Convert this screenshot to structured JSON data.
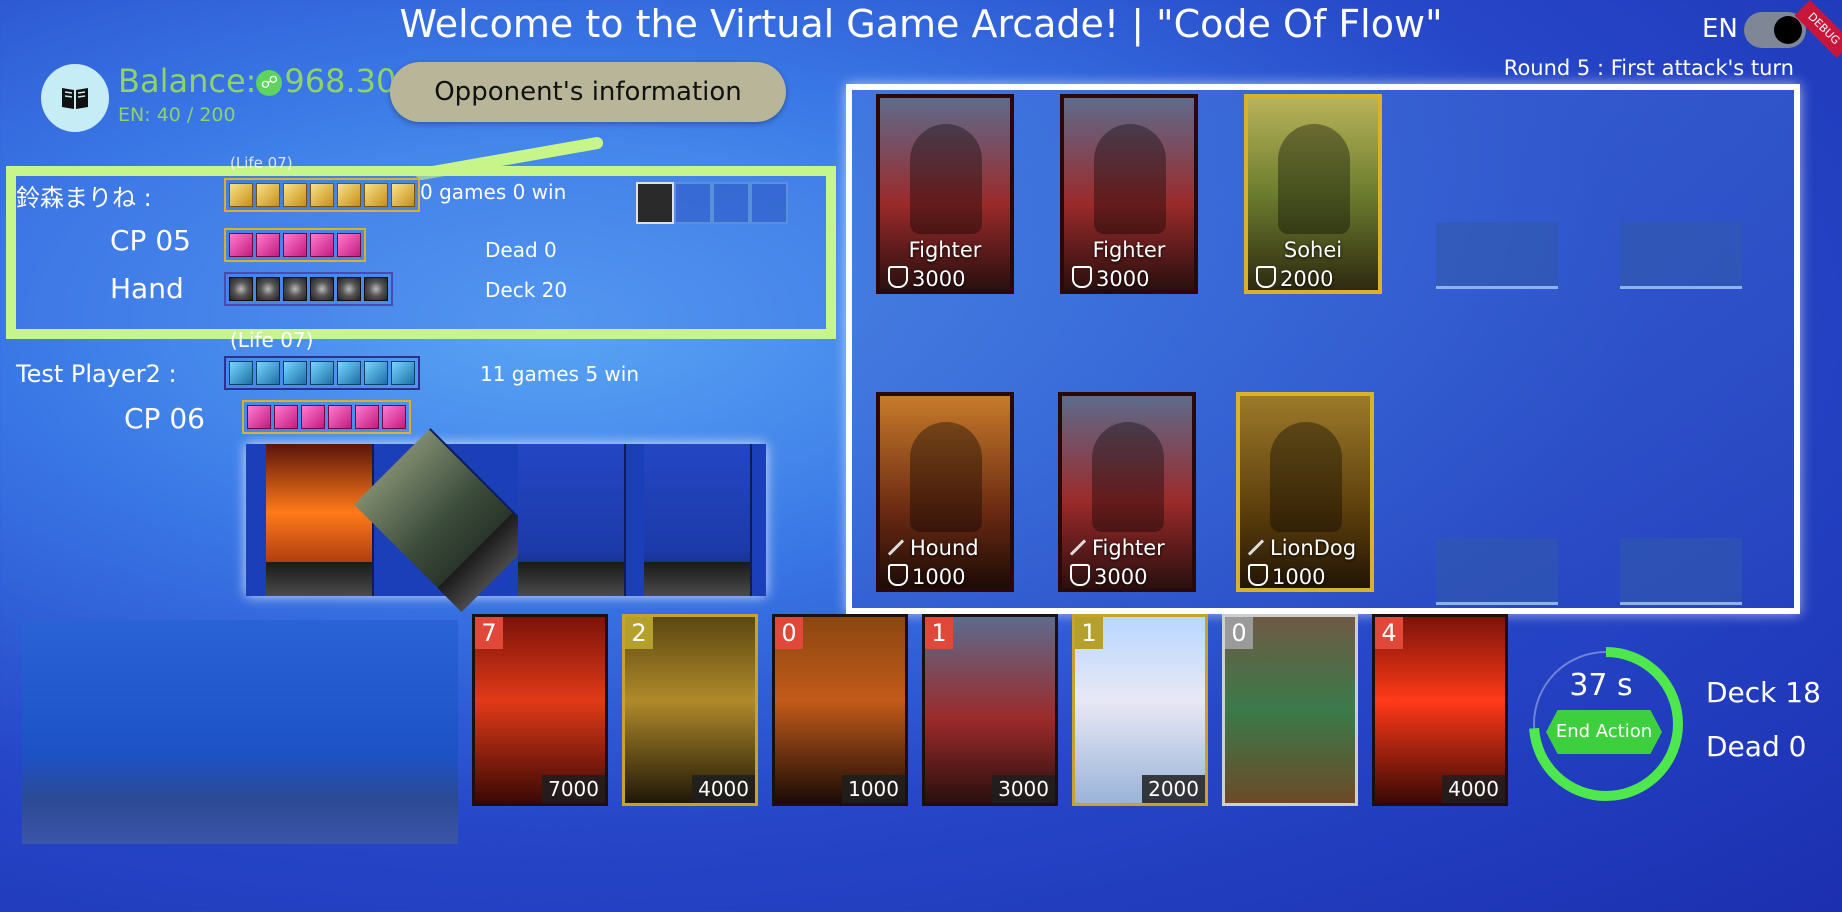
{
  "header": {
    "title": "Welcome to the Virtual Game Arcade! | \"Code Of Flow\"",
    "lang": "EN",
    "round_info": "Round 5 : First attack's turn",
    "ribbon": "DEBUG"
  },
  "status": {
    "balance_label": "Balance:",
    "balance_value": "968.30",
    "en_value": "EN:  40 / 200"
  },
  "callout": "Opponent's information",
  "opponent": {
    "name": "鈴森まりね :",
    "life_label": "(Life 07)",
    "life_count": 7,
    "record": "0 games 0 win",
    "cp_label": "CP 05",
    "cp_count": 5,
    "dead": "Dead 0",
    "hand_label": "Hand",
    "hand_count": 6,
    "deck": "Deck 20"
  },
  "player": {
    "life_label": "(Life 07)",
    "name": "Test Player2 :",
    "life_count": 7,
    "record": "11 games 5 win",
    "cp_label": "CP 06",
    "cp_count": 6
  },
  "board": {
    "opponent_row": [
      {
        "name": "Fighter",
        "power": "3000"
      },
      {
        "name": "Fighter",
        "power": "3000"
      },
      {
        "name": "Sohei",
        "power": "2000"
      }
    ],
    "player_row": [
      {
        "name": "Hound",
        "power": "1000"
      },
      {
        "name": "Fighter",
        "power": "3000"
      },
      {
        "name": "LionDog",
        "power": "1000"
      }
    ]
  },
  "hand": [
    {
      "cost": "7",
      "value": "7000"
    },
    {
      "cost": "2",
      "value": "4000"
    },
    {
      "cost": "0",
      "value": "1000"
    },
    {
      "cost": "1",
      "value": "3000"
    },
    {
      "cost": "1",
      "value": "2000"
    },
    {
      "cost": "0",
      "value": ""
    },
    {
      "cost": "4",
      "value": "4000"
    }
  ],
  "timer": {
    "seconds": "37 s",
    "end_action": "End Action",
    "progress": 0.74
  },
  "player_counts": {
    "deck": "Deck 18",
    "dead": "Dead 0"
  },
  "colors": {
    "accent_green": "#c8f58a",
    "balance_green": "#8fd16a",
    "end_button": "#3dcf3d"
  }
}
